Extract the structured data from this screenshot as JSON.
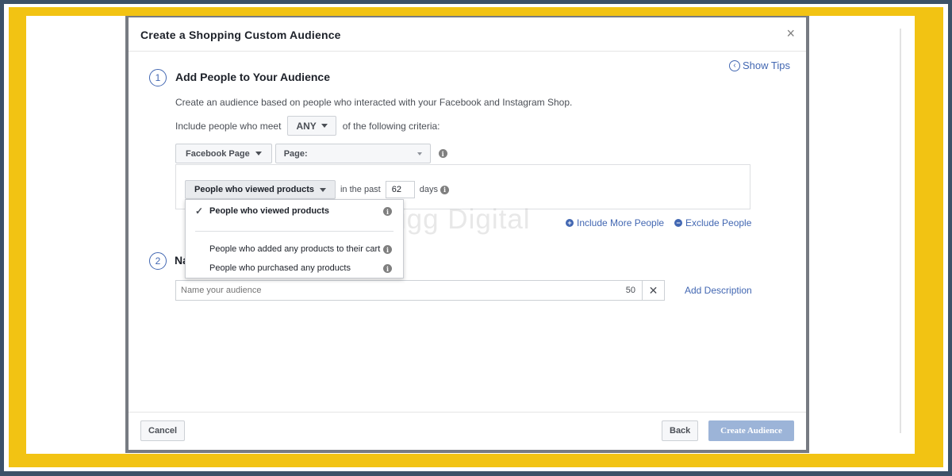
{
  "modal": {
    "title": "Create a Shopping Custom Audience",
    "close": "×",
    "show_tips": "Show Tips",
    "tips_icon": "‹"
  },
  "step1": {
    "number": "1",
    "title": "Add People to Your Audience",
    "description": "Create an audience based on people who interacted with your Facebook and Instagram Shop.",
    "criteria_prefix": "Include people who meet",
    "criteria_value": "ANY",
    "criteria_suffix": "of the following criteria:",
    "source_label": "Facebook Page",
    "page_label": "Page:",
    "event_label": "People who viewed products",
    "in_the_past": "in the past",
    "days_value": "62",
    "days_label": "days",
    "include_more": "Include More People",
    "exclude": "Exclude People"
  },
  "dropdown": {
    "items": [
      {
        "label": "People who viewed products",
        "selected": true
      },
      {
        "label": "People who added any products to their cart",
        "selected": false
      },
      {
        "label": "People who purchased any products",
        "selected": false
      }
    ]
  },
  "step2": {
    "number": "2",
    "title_visible": "Na",
    "name_placeholder": "Name your audience",
    "char_count": "50",
    "add_description": "Add Description"
  },
  "footer": {
    "cancel": "Cancel",
    "back": "Back",
    "create": "Create Audience"
  },
  "watermark": "Grigg Digital",
  "colors": {
    "accent": "#4267b2",
    "frame": "#f2c313",
    "background": "#3c5168",
    "primary_disabled": "#9cb4d8"
  }
}
